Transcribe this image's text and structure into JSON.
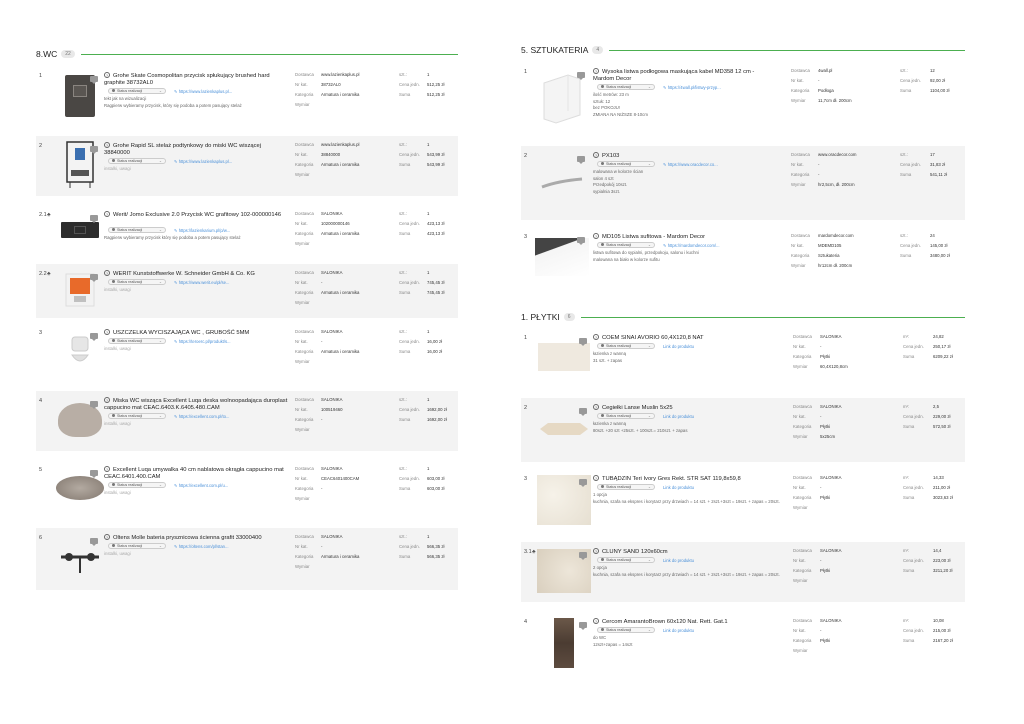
{
  "left": {
    "title": "8.WC",
    "badge": "22",
    "labels": {
      "supplier": "Dostawca",
      "catno": "Nr kat.",
      "category": "Kategoria",
      "dims": "Wymiar",
      "qty": "szt.:",
      "unit_price": "Cena jedn.",
      "total": "Suma"
    },
    "rows": [
      {
        "num": "1",
        "name": "Grohe Skate Cosmopolitan przycisk spłukujący brushed hard graphite 38732AL0",
        "status": "Status realizacji",
        "link": "https://www.lazienkaplus.pl...",
        "notes": [
          "tekt jak na wizualizacji",
          "Ragpierw wybieramy przycisk, który się podoba a potem pasujący stelaż"
        ],
        "supplier": "www.lazienkaplus.pl",
        "catno": "38732AL0",
        "category": "Armatura i ceramika",
        "dims": "",
        "qty": "1",
        "unit_price": "512,25 zł",
        "total": "512,25 zł"
      },
      {
        "num": "2",
        "name": "Grohe Rapid SL stelaż podtynkowy do miski WC wiszącej 38840000",
        "status": "Status realizacji",
        "link": "https://www.lazienkaplus.pl...",
        "notes": [
          "instalki, uwagi"
        ],
        "supplier": "www.lazienkaplus.pl",
        "catno": "38840000",
        "category": "Armatura i ceramika",
        "dims": "",
        "qty": "1",
        "unit_price": "543,99 zł",
        "total": "543,99 zł"
      },
      {
        "num": "2.1",
        "name": "Werit/ Jomo Exclusive 2.0 Przycisk WC grafitowy 102-000000146",
        "status": "Status realizacji",
        "link": "https://lazienkarium.pl/p/w...",
        "notes": [
          "Ragpierw wybieramy przycisk który się podoba a potem pasujący stelaż"
        ],
        "supplier": "SALONIKA",
        "catno": "102000000146",
        "category": "Armatura i ceramika",
        "dims": "",
        "qty": "1",
        "unit_price": "423,13 zł",
        "total": "423,13 zł"
      },
      {
        "num": "2.2",
        "name": "WERIT Kunststoffwerke W. Schneider GmbH & Co. KG",
        "status": "Status realizacji",
        "link": "https://www.werit.eu/pl/se...",
        "notes": [
          "instalki, uwagi"
        ],
        "supplier": "SALONIKA",
        "catno": "-",
        "category": "Armatura i ceramika",
        "dims": "",
        "qty": "1",
        "unit_price": "745,45 zł",
        "total": "745,45 zł"
      },
      {
        "num": "3",
        "name": "USZCZELKA WYCISZAJĄCA WC , GRUBOŚĆ 5MM",
        "status": "Status realizacji",
        "link": "https://teroerc.pl/produkt/s...",
        "notes": [
          "instalki, uwagi"
        ],
        "supplier": "SALONIKA",
        "catno": "-",
        "category": "Armatura i ceramika",
        "dims": "",
        "qty": "1",
        "unit_price": "16,00 zł",
        "total": "16,00 zł"
      },
      {
        "num": "4",
        "name": "Miska WC wisząca Excellent Luqa deska wolnoopadająca duroplast cappucino mat CEAC.6403.K.6405.480.CAM",
        "status": "Status realizacji",
        "link": "https://excellent.com.pl/to...",
        "notes": [
          "instalki, uwagi"
        ],
        "supplier": "SALONIKA",
        "catno": "100519460",
        "category": "-",
        "dims": "",
        "qty": "1",
        "unit_price": "1692,00 zł",
        "total": "1692,00 zł"
      },
      {
        "num": "5",
        "name": "Excellent Luqa umywalka 40 cm nablatowa okrągła cappucino mat CEAC.6401.400.CAM",
        "status": "Status realizacji",
        "link": "https://excellent.com.pl/u...",
        "notes": [
          "instalki, uwagi"
        ],
        "supplier": "SALONIKA",
        "catno": "CEAC6401400CAM",
        "category": "-",
        "dims": "",
        "qty": "1",
        "unit_price": "603,00 zł",
        "total": "603,00 zł"
      },
      {
        "num": "6",
        "name": "Oltens Molle bateria prysznicowa ścienna grafit 33000400",
        "status": "Status realizacji",
        "link": "https://oltens.com/pl/stan...",
        "notes": [
          "instalki, uwagi"
        ],
        "supplier": "SALONIKA",
        "catno": "-",
        "category": "Armatura i ceramika",
        "dims": "",
        "qty": "1",
        "unit_price": "566,35 zł",
        "total": "566,35 zł"
      }
    ]
  },
  "right_top": {
    "title": "5. SZTUKATERIA",
    "badge": "4",
    "labels": {
      "supplier": "Dostawca",
      "catno": "Nr kat.",
      "category": "Kategoria",
      "dims": "Wymiar",
      "qty": "szt.:",
      "unit_price": "Cena jedn.",
      "total": "Suma"
    },
    "rows": [
      {
        "num": "1",
        "name": "Wysoka listwa podłogowa maskująca kabel MD358 12 cm - Mardom Decor",
        "status": "Status realizacji",
        "link": "https://4wall.pl/listwy-przyp...",
        "notes": [
          "ilość metrów: 23 m",
          "sztuk: 12",
          "bez POKOJU!",
          "ZMIANA NA NIŻSZE 8-10cm"
        ],
        "supplier": "4wall.pl",
        "catno": "-",
        "category": "Podłoga",
        "dims": "11,7cm dł. 200cm",
        "qty": "12",
        "unit_price": "92,00 zł",
        "total": "1104,00 zł"
      },
      {
        "num": "2",
        "name": "PX103",
        "status": "Status realizacji",
        "link": "https://www.oracdecor.co...",
        "notes": [
          "malowana w kolorze ścian",
          "salon 4 szt",
          "Przedpokój 10szt.",
          "sypialnia 3szt."
        ],
        "supplier": "www.oracdecor.com",
        "catno": "-",
        "category": "-",
        "dims": "hr2,5cm, dł. 200cm",
        "qty": "17",
        "unit_price": "31,83 zł",
        "total": "541,11 zł"
      },
      {
        "num": "3",
        "name": "MD105 Listwa sufitowa - Mardom Decor",
        "status": "Status realizacji",
        "link": "https://mardomdecor.com/...",
        "notes": [
          "listwa sufitowa do sypialni, przedpokoju, salonu i kuchni",
          "malowana na biało w kolorze sufitu"
        ],
        "supplier": "mardomdecor.com",
        "catno": "MDEMD105",
        "category": "Sztukateria",
        "dims": "hr12cm dł. 200cm",
        "qty": "24",
        "unit_price": "145,00 zł",
        "total": "3480,00 zł"
      }
    ]
  },
  "right_bottom": {
    "title": "1. PŁYTKI",
    "badge": "6",
    "labels": {
      "supplier": "Dostawca",
      "catno": "Nr kat.",
      "category": "Kategoria",
      "dims": "Wymiar",
      "qty": "m²:",
      "unit_price": "Cena jedn.",
      "total": "Suma"
    },
    "rows": [
      {
        "num": "1",
        "name": "COEM SINAI AVORIO 60,4X120,8 NAT",
        "status": "Status realizacji",
        "link": "Link do produktu",
        "notes": [
          "łazienka z wanną",
          "31 szt. + zapas"
        ],
        "supplier": "SALONIKA",
        "catno": "-",
        "category": "Płytki",
        "dims": "60,4X120,8cm",
        "qty": "24,82",
        "unit_price": "250,17 zł",
        "total": "6209,22 zł"
      },
      {
        "num": "2",
        "name": "Cegiełki Lanse Muslin 5x25",
        "status": "Status realizacji",
        "link": "Link do produktu",
        "notes": [
          "łazienka z wanną",
          "80szt. +20 szt +25szt. + 100szt.= 210szt. + zapas"
        ],
        "supplier": "SALONIKA",
        "catno": "-",
        "category": "Płytki",
        "dims": "5x25cm",
        "qty": "2,5",
        "unit_price": "229,00 zł",
        "total": "572,50 zł"
      },
      {
        "num": "3",
        "name": "TUBĄDZIN Teri Ivory Gres Rekt. STR SAT 119,8x59,8",
        "status": "Status realizacji",
        "link": "Link do produktu",
        "notes": [
          "1 opcja",
          "kuchnia, szafa na ekspres i korytarz przy drzwiach = 14 szt. + 2szt.+3szt = 19szt. + zapas = 20szt."
        ],
        "supplier": "SALONIKA",
        "catno": "-",
        "category": "Płytki",
        "dims": "",
        "qty": "14,33",
        "unit_price": "211,00 zł",
        "total": "3023,63 zł"
      },
      {
        "num": "3.1",
        "name": "CLUNY SAND 120x60cm",
        "status": "Status realizacji",
        "link": "Link do produktu",
        "notes": [
          "2 opcja",
          "kuchnia, szafa na ekspres i korytarz przy drzwiach = 14 szt. + 2szt.+3szt = 19szt. + zapas = 20szt."
        ],
        "supplier": "SALONIKA",
        "catno": "-",
        "category": "Płytki",
        "dims": "",
        "qty": "14,4",
        "unit_price": "223,00 zł",
        "total": "3211,20 zł"
      },
      {
        "num": "4",
        "name": "Cercom AmarantoBrown 60x120 Nat. Rett. Gat.1",
        "status": "Status realizacji",
        "link": "Link do produktu",
        "notes": [
          "do WC",
          "12szt+zapas = 14szt"
        ],
        "supplier": "SALONIKA",
        "catno": "-",
        "category": "Płytki",
        "dims": "",
        "qty": "10,08",
        "unit_price": "215,00 zł",
        "total": "2167,20 zł"
      }
    ]
  }
}
